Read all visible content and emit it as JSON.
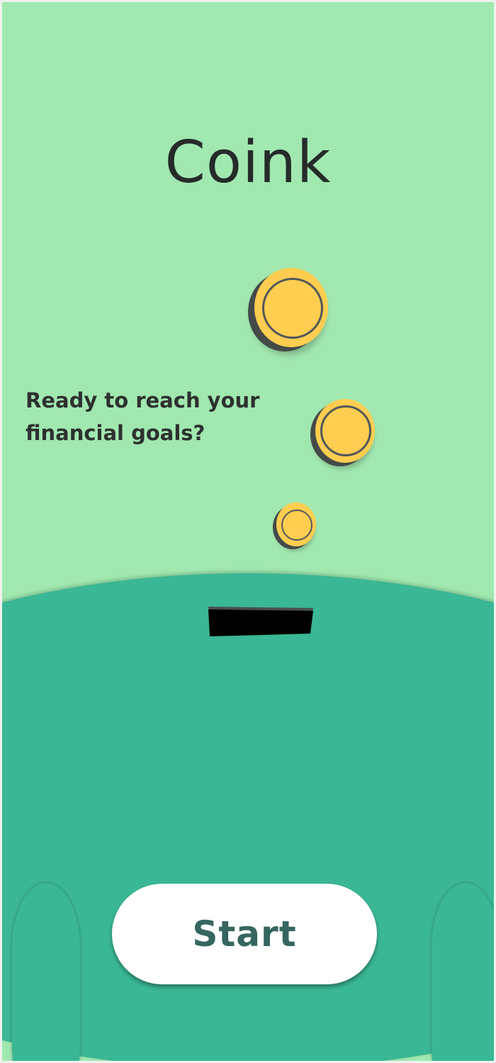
{
  "app": {
    "title": "Coink",
    "tagline": [
      "Ready to reach your",
      "financial goals?"
    ]
  },
  "actions": {
    "start_label": "Start"
  },
  "theme": {
    "background": "#a1e8b0",
    "piggy_green": "#3ab794",
    "coin_gold": "#ffcd50",
    "button_text": "#35665f"
  },
  "icons": [
    "coin-icon",
    "coin-slot-icon",
    "piggy-bank-illustration"
  ]
}
